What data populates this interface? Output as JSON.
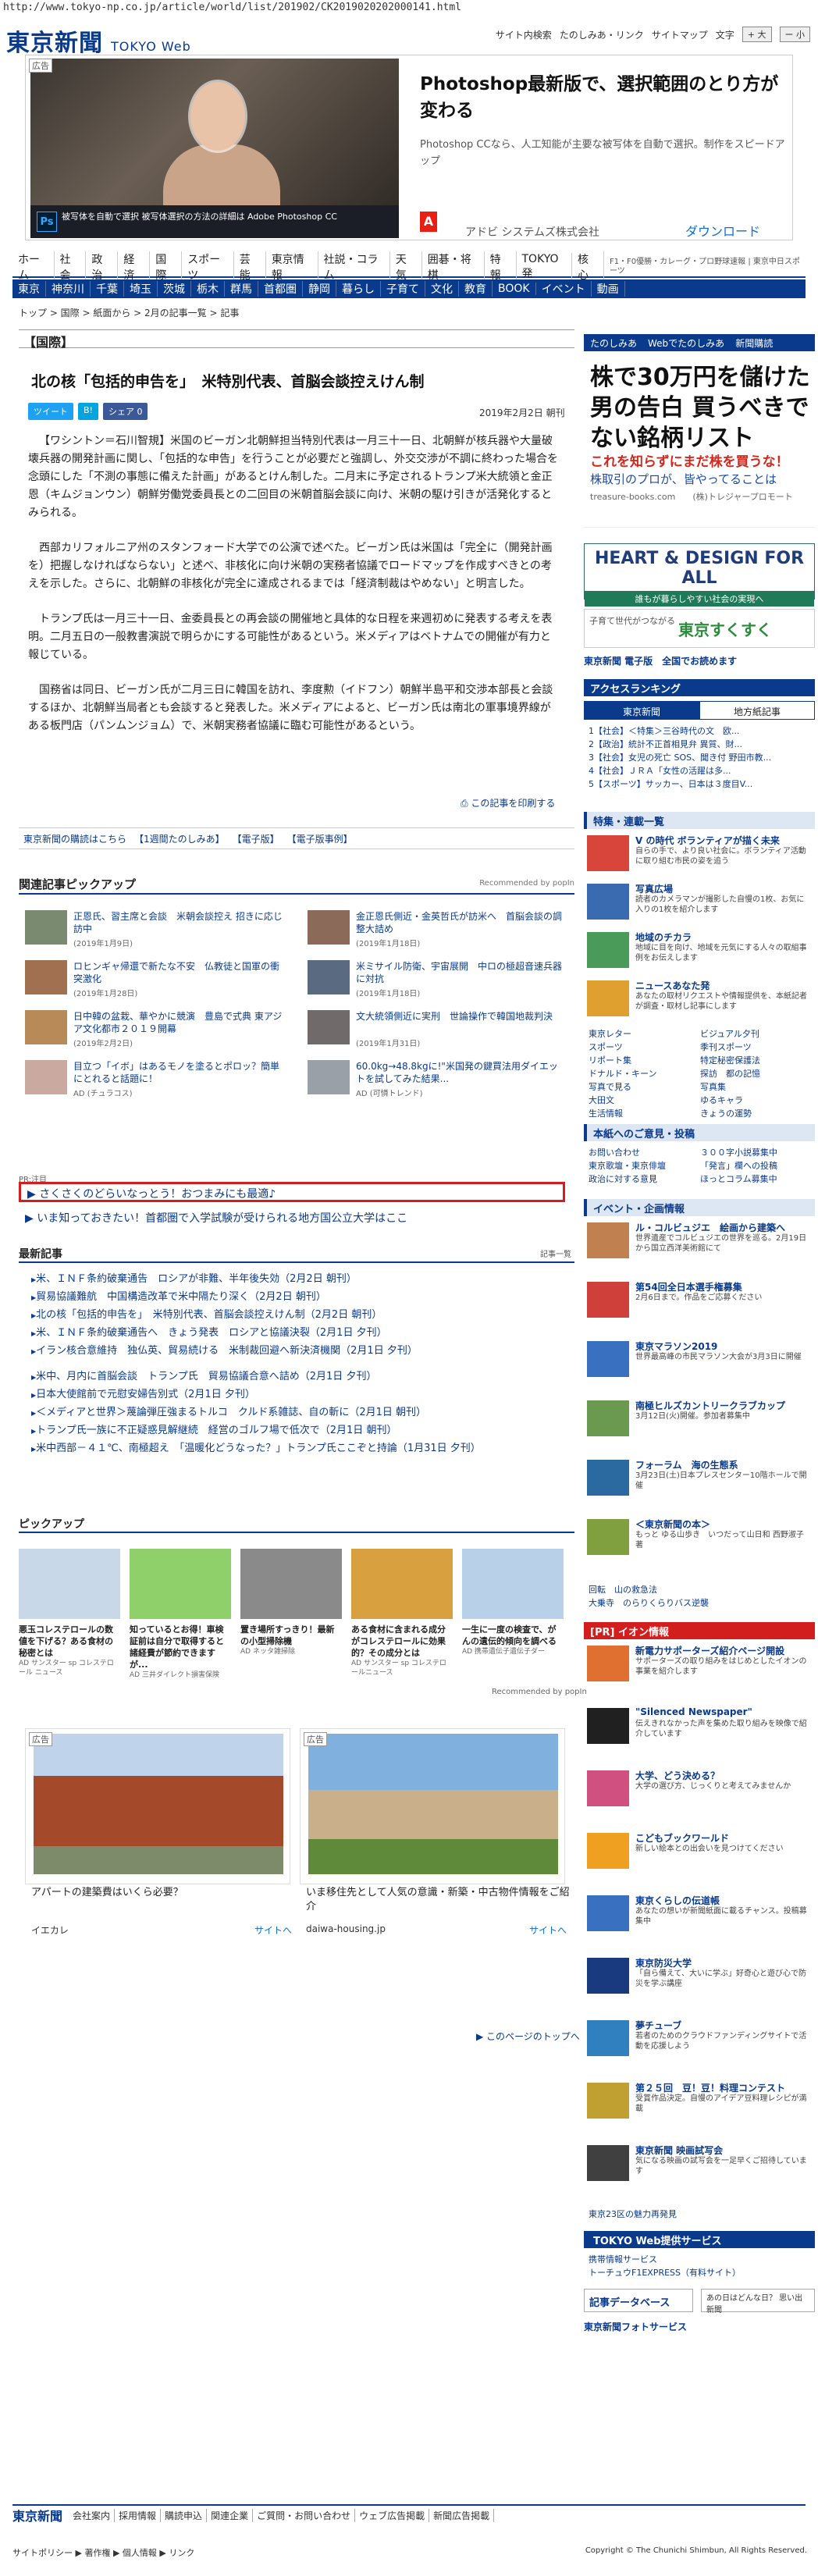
{
  "url": "http://www.tokyo-np.co.jp/article/world/list/201902/CK2019020202000141.html",
  "logo": "東京新聞",
  "logo_sub": "TOKYO Web",
  "toplinks": [
    "サイト内検索",
    "たのしみあ・リンク",
    "サイトマップ",
    "文字",
    "+",
    "大",
    "ー",
    "小"
  ],
  "topad": {
    "tag": "広告",
    "title": "Photoshop最新版で、選択範囲のとり方が変わる",
    "desc": "Photoshop CCなら、人工知能が主要な被写体を自動で選択。制作をスピードアップ",
    "corp": "アドビ システムズ株式会社",
    "download": "ダウンロード",
    "band": "被写体を自動で選択 被写体選択の方法の詳細は Adobe Photoshop CC",
    "ps": "Ps",
    "adobe": "A"
  },
  "nav1": [
    "ホーム",
    "社会",
    "政治",
    "経済",
    "国際",
    "スポーツ",
    "芸能",
    "東京情報",
    "社説・コラム",
    "天気",
    "囲碁・将棋",
    "特報",
    "TOKYO発",
    "核心"
  ],
  "nav1_right": "F1・F0優勝・カレーグ・プロ野球速報 | 東京中日スポーツ",
  "nav2": [
    "東京",
    "神奈川",
    "千葉",
    "埼玉",
    "茨城",
    "栃木",
    "群馬",
    "首都圏",
    "静岡",
    "暮らし",
    "子育て",
    "文化",
    "教育",
    "BOOK",
    "イベント",
    "動画"
  ],
  "crumb": "トップ > 国際 > 紙面から > 2月の記事一覧 > 記事",
  "section": "【国際】",
  "headline": "北の核「包括的申告を」　米特別代表、首脳会談控えけん制",
  "share": [
    "ツイート",
    "B!",
    "シェア 0"
  ],
  "date": "2019年2月2日 朝刊",
  "paragraphs": [
    "【ワシントン＝石川智規】米国のビーガン北朝鮮担当特別代表は一月三十一日、北朝鮮が核兵器や大量破壊兵器の開発計画に関し、「包括的な申告」を行うことが必要だと強調し、外交交渉が不調に終わった場合を念頭にした「不測の事態に備えた計画」があるとけん制した。二月末に予定されるトランプ米大統領と金正恩（キムジョンウン）朝鮮労働党委員長との二回目の米朝首脳会談に向け、米朝の駆け引きが活発化するとみられる。",
    "西部カリフォルニア州のスタンフォード大学での公演で述べた。ビーガン氏は米国は「完全に（開発計画を）把握しなければならない」と述べ、非核化に向け米朝の実務者協議でロードマップを作成すべきとの考えを示した。さらに、北朝鮮の非核化が完全に達成されるまでは「経済制裁はやめない」と明言した。",
    "トランプ氏は一月三十一日、金委員長との再会談の開催地と具体的な日程を来週初めに発表する考えを表明。二月五日の一般教書演説で明らかにする可能性があるという。米メディアはベトナムでの開催が有力と報じている。",
    "国務省は同日、ビーガン氏が二月三日に韓国を訪れ、李度勲（イドフン）朝鮮半島平和交渉本部長と会談するほか、北朝鮮当局者とも会談すると発表した。米メディアによると、ビーガン氏は南北の軍事境界線がある板門店（パンムンジョム）で、米朝実務者協議に臨む可能性があるという。"
  ],
  "print": "この記事を印刷する",
  "links": [
    "東京新聞の購読はこちら",
    "【1週間たのしみあ】",
    "【電子版】",
    "【電子版事例】"
  ],
  "related_head": "関連記事ピックアップ",
  "recommended": "Recommended by popIn",
  "related": [
    {
      "t": "正恩氏、習主席と会談　米朝会談控え 招きに応じ訪中",
      "d": "(2019年1月9日)"
    },
    {
      "t": "金正恩氏側近・金英哲氏が訪米へ　首脳会談の調整大詰め",
      "d": "(2019年1月18日)"
    },
    {
      "t": "ロヒンギャ帰還で新たな不安　仏教徒と国軍の衝突激化",
      "d": "(2019年1月28日)"
    },
    {
      "t": "米ミサイル防衛、宇宙展開　中ロの極超音速兵器に対抗",
      "d": "(2019年1月18日)"
    },
    {
      "t": "日中韓の盆栽、華やかに競演　豊島で式典 東アジア文化都市２０１９開幕",
      "d": "(2019年2月2日)"
    },
    {
      "t": "文大統領側近に実刑　世論操作で韓国地裁判決",
      "d": "(2019年1月31日)"
    },
    {
      "t": "目立つ「イボ」はあるモノを塗るとポロッ？簡単にとれると話題に！",
      "d": "AD (チュラコス)"
    },
    {
      "t": "60.0kg→48.8kgに!\"米国発の鍵買法用ダイエットを試してみた結果...",
      "d": "AD (可憐トレンド)"
    }
  ],
  "pr_tag": "PR:注目",
  "pr_box": "さくさくのどらいなっとう！おつまみにも最適♪",
  "pr_line": "いま知っておきたい！首都圏で入学試験が受けられる地方国公立大学はここ",
  "latest_head": "最新記事",
  "latest_small": "記事一覧",
  "latest": [
    "米、ＩＮＦ条約破棄通告　ロシアが非難、半年後失効（2月2日 朝刊）",
    "貿易協議難航　中国構造改革で米中隔たり深く（2月2日 朝刊）",
    "北の核「包括的申告を」　米特別代表、首脳会談控えけん制（2月2日 朝刊）",
    "米、ＩＮＦ条約破棄通告へ　きょう発表　ロシアと協議決裂（2月1日 夕刊）",
    "イラン核合意維持　独仏英、貿易続ける　米制裁回避へ新決済機関（2月1日 夕刊）",
    "米中、月内に首脳会談　トランプ氏　貿易協議合意へ詰め（2月1日 夕刊）",
    "日本大使館前で元慰安婦告別式（2月1日 夕刊）",
    "＜メディアと世界＞蔑論弾圧強まるトルコ　クルド系雑誌、自の斬に（2月1日 朝刊）",
    "トランプ氏一族に不正疑惑見解継続　経営のゴルフ場で低次で（2月1日 朝刊）",
    "米中西部－４１℃、南極超え　「温暖化どうなった？」トランプ氏ここぞと持論（1月31日 夕刊）"
  ],
  "pick_head": "ピックアップ",
  "pick": [
    {
      "t": "悪玉コレステロールの数値を下げる？ある食材の秘密とは",
      "s": "AD サンスター sp コレステロール ニュース"
    },
    {
      "t": "知っているとお得！車検証前は自分で取得すると諸経費が節約できますが...",
      "s": "AD 三井ダイレクト損害保険"
    },
    {
      "t": "置き場所すっきり！最新の小型掃除機",
      "s": "AD ネッタ雑掃除"
    },
    {
      "t": "ある食材に含まれる成分がコレステロールに効果的？その成分とは",
      "s": "AD サンスター sp コレステロールニュース"
    },
    {
      "t": "一生に一度の検査で、がんの遺伝的傾向を調べる",
      "s": "AD 携帯遺伝子遺伝子ダー"
    }
  ],
  "ad2": [
    {
      "tag": "広告",
      "cap": "アパートの建築費はいくら必要？",
      "src": "イエカレ",
      "sv": "サイトへ"
    },
    {
      "tag": "広告",
      "cap": "いま移住先として人気の意識・新築・中古物件情報をご紹介",
      "src": "daiwa-housing.jp",
      "sv": "サイトへ"
    }
  ],
  "pagetop": "▶ このページのトップへ",
  "side": {
    "tabs": [
      "たのしみあ",
      "Webでたのしみあ",
      "新聞購読"
    ],
    "stock": {
      "big": "株で30万円を儲けた男の告白 買うべきでない銘柄リスト",
      "red": "これを知らずにまだ株を買うな！",
      "blue": "株取引のプロが、皆やってることは",
      "dom": "treasure-books.com　　(株)トレジャープロモート"
    },
    "hd": {
      "a": "HEART & DESIGN FOR ALL",
      "b": "誰もが暮らしやすい社会の実現へ"
    },
    "suku": {
      "t1": "子育て世代がつながる",
      "t2": "東京すくすく"
    },
    "epaper": "東京新聞 電子版　全国でお読めます",
    "rank_head": "アクセスランキング",
    "rank_tabs": [
      "東京新聞",
      "地方紙記事"
    ],
    "rank": [
      "1【社会】＜特集＞三谷時代の文　欧...",
      "2【政治】統計不正首相見弁 異質、財...",
      "3【社会】女児の死亡 SOS、聞き付 野田市教...",
      "4【社会】ＪＲＡ「女性の活躍は多...",
      "5【スポーツ】サッカー、日本は３度目V..."
    ],
    "feat_head": "特集・連載一覧",
    "feats": [
      {
        "t": "V の時代 ボランティアが描く未来",
        "d": "自らの手で、より良い社会に。ボランティア活動に取り組む市民の姿を追う"
      },
      {
        "t": "写真広場",
        "d": "読者のカメラマンが撮影した自慢の1枚、お気に入りの1枚を紹介します"
      },
      {
        "t": "地域のチカラ",
        "d": "地域に目を向け、地域を元気にする人々の取組事例をお伝えします"
      },
      {
        "t": "ニュースあなた発",
        "d": "あなたの取材リクエストや情報提供を、本紙記者が調査・取材し記事にします"
      }
    ],
    "grid": [
      "東京レター",
      "ビジュアル夕刊",
      "スポーツ",
      "季刊スポーツ",
      "リポート集",
      "特定秘密保護法",
      "ドナルド・キーン",
      "探訪　都の記憶",
      "写真で見る",
      "写真集",
      "大田文",
      "ゆるキャラ",
      "生活情報",
      "きょうの運勢"
    ],
    "reader_head": "本紙へのご意見・投稿",
    "reader": [
      "お問い合わせ",
      "３００字小説募集中",
      "東京歌壇・東京俳壇",
      "「発言」欄への投稿",
      "政治に対する意見",
      "ほっとコラム募集中"
    ],
    "event_head": "イベント・企画情報",
    "events": [
      {
        "t": "ル・コルビュジエ　絵画から建築へ",
        "d": "世界遺産でコルビュジエの世界を巡る。2月19日から国立西洋美術館にて"
      },
      {
        "t": "第54回全日本選手権募集",
        "d": "2月6日まで。作品をご応募ください"
      },
      {
        "t": "東京マラソン2019",
        "d": "世界最高峰の市民マラソン大会が3月3日に開催"
      },
      {
        "t": "南極ヒルズカントリークラブカップ",
        "d": "3月12日(火)開催。参加者募集中"
      },
      {
        "t": "フォーラム　海の生態系",
        "d": "3月23日(土)日本プレスセンター10階ホールで開催"
      },
      {
        "t": "＜東京新聞の本＞",
        "d": "もっと ゆる山歩き　いつだって山日和 西野淑子 著"
      }
    ],
    "events_links": [
      "回転　山の救急法",
      "大乗寺　のらりくらりバス逆襲"
    ],
    "iion_head": "[PR] イオン情報",
    "iion": [
      {
        "t": "新電力サポーターズ紹介ページ開設",
        "d": "サポーターズの取り組みをはじめとしたイオンの事業を紹介します"
      },
      {
        "t": "\"Silenced Newspaper\"",
        "d": "伝えきれなかった声を集めた取り組みを映像で紹介しています"
      },
      {
        "t": "大学、どう決める？",
        "d": "大学の選び方、じっくりと考えてみませんか"
      },
      {
        "t": "こどもブックワールド",
        "d": "新しい絵本との出会いを見つけてください"
      },
      {
        "t": "東京くらしの伝道帳",
        "d": "あなたの想いが新聞紙面に載るチャンス。投稿募集中"
      },
      {
        "t": "東京防災大学",
        "d": "「自ら備えて、大いに学ぶ」好奇心と遊び心で防災を学ぶ講座"
      },
      {
        "t": "夢チューブ",
        "d": "若者のためのクラウドファンディングサイトで活動を応援しよう"
      },
      {
        "t": "第２５回　豆！豆！料理コンテスト",
        "d": "受賞作品決定。自慢のアイデア豆料理レシピが満載"
      },
      {
        "t": "東京新聞 映画試写会",
        "d": "気になる映画の試写会を一足早くご招待しています"
      }
    ],
    "miryoku": "東京23区の魅力再発見",
    "svc_head": "TOKYO Web提供サービス",
    "svc": [
      "携帯情報サービス",
      "トーチュウF1EXPRESS（有料サイト）"
    ],
    "db": "記事データベース",
    "kara": "あの日はどんな日？ 思い出新聞",
    "photo": "東京新聞フォトサービス"
  },
  "footer": {
    "logo": "東京新聞",
    "items": [
      "会社案内",
      "採用情報",
      "購読申込",
      "関連企業",
      "ご質問・お問い合わせ",
      "ウェブ広告掲載",
      "新聞広告掲載"
    ],
    "bottom": "サイトポリシー ▶ 著作権 ▶ 個人情報 ▶ リンク",
    "copy": "Copyright © The Chunichi Shimbun, All Rights Reserved."
  },
  "colors": {
    "brand": "#0a3a8c",
    "pr_red": "#d31e1e"
  }
}
